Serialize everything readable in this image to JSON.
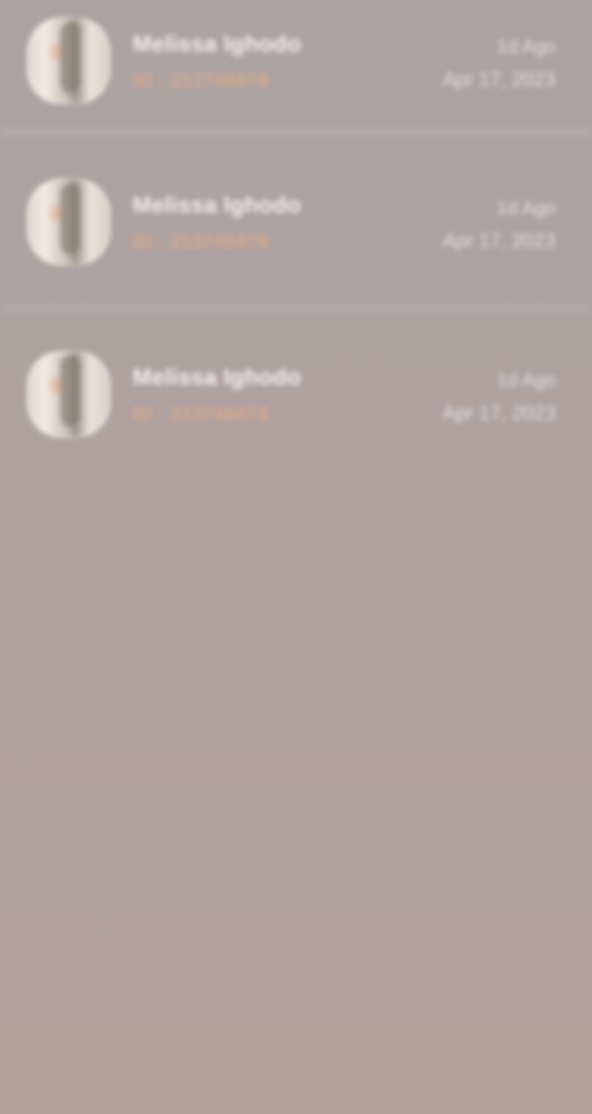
{
  "messages": [
    {
      "name": "Melissa Ighodo",
      "id_text": "ID : 213748478",
      "relative_time": "1d Ago",
      "date": "Apr 17, 2023"
    },
    {
      "name": "Melissa Ighodo",
      "id_text": "ID : 213748478",
      "relative_time": "1d Ago",
      "date": "Apr 17, 2023"
    },
    {
      "name": "Melissa Ighodo",
      "id_text": "ID : 213748478",
      "relative_time": "1d Ago",
      "date": "Apr 17, 2023"
    }
  ],
  "colors": {
    "background": "#b0a1a0",
    "name_text": "#f4f0ef",
    "id_accent": "#d6a88c",
    "meta_text": "#e6dfdf"
  }
}
